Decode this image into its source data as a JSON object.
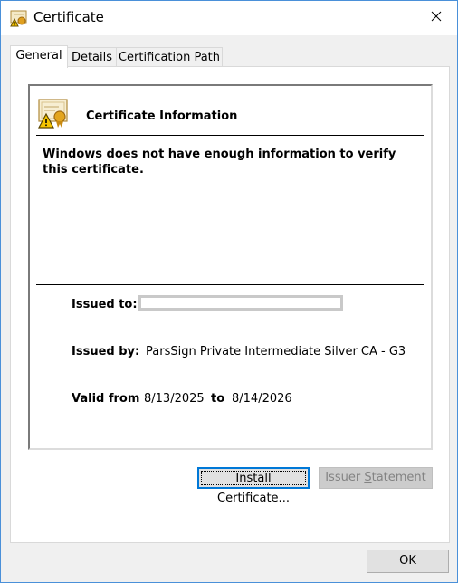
{
  "window": {
    "title": "Certificate",
    "close_glyph": "✕"
  },
  "tabs": [
    {
      "label": "General",
      "active": true
    },
    {
      "label": "Details",
      "active": false
    },
    {
      "label": "Certification Path",
      "active": false
    }
  ],
  "cert_info": {
    "heading": "Certificate Information",
    "warning": "Windows does not have enough information to verify this certificate.",
    "issued_to_label": "Issued to:",
    "issued_to_value": "",
    "issued_by_label": "Issued by:",
    "issued_by_value": "ParsSign Private Intermediate Silver CA - G3",
    "valid_from_label": "Valid from",
    "valid_from_value": "8/13/2025",
    "valid_to_label": "to",
    "valid_to_value": "8/14/2026"
  },
  "buttons": {
    "install": {
      "prefix": "",
      "accel": "I",
      "rest": "nstall Certificate..."
    },
    "issuer": {
      "prefix": "Issuer ",
      "accel": "S",
      "rest": "tatement"
    },
    "ok": "OK"
  },
  "icons": {
    "window_icon": "certificate-warning-icon",
    "cert_icon": "certificate-warning-icon",
    "close": "close-icon"
  },
  "colors": {
    "focus_border": "#0078d7",
    "disabled_text": "#838383"
  }
}
